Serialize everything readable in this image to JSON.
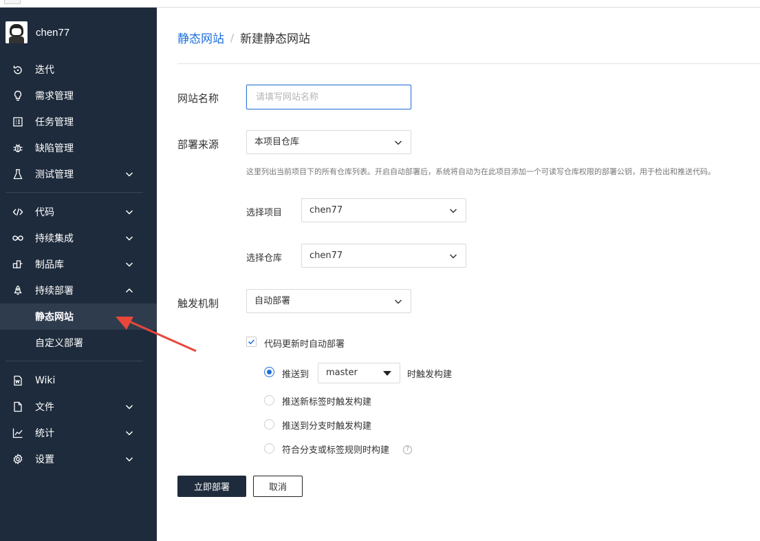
{
  "user": {
    "name": "chen77"
  },
  "sidebar": {
    "items": [
      {
        "key": "iteration",
        "label": "迭代",
        "icon": "iteration-icon",
        "chevron": ""
      },
      {
        "key": "requirements",
        "label": "需求管理",
        "icon": "lightbulb-icon",
        "chevron": ""
      },
      {
        "key": "tasks",
        "label": "任务管理",
        "icon": "task-list-icon",
        "chevron": ""
      },
      {
        "key": "defects",
        "label": "缺陷管理",
        "icon": "bug-icon",
        "chevron": ""
      },
      {
        "key": "testing",
        "label": "测试管理",
        "icon": "flask-icon",
        "chevron": "down"
      },
      {
        "key": "code",
        "label": "代码",
        "icon": "code-icon",
        "chevron": "down"
      },
      {
        "key": "ci",
        "label": "持续集成",
        "icon": "infinity-icon",
        "chevron": "down"
      },
      {
        "key": "artifacts",
        "label": "制品库",
        "icon": "artifact-icon",
        "chevron": "down"
      },
      {
        "key": "cd",
        "label": "持续部署",
        "icon": "rocket-icon",
        "chevron": "up"
      },
      {
        "key": "static-site",
        "label": "静态网站",
        "icon": "",
        "chevron": "",
        "active": true
      },
      {
        "key": "custom-deploy",
        "label": "自定义部署",
        "icon": "",
        "chevron": ""
      },
      {
        "key": "wiki",
        "label": "Wiki",
        "icon": "wiki-icon",
        "chevron": ""
      },
      {
        "key": "files",
        "label": "文件",
        "icon": "file-icon",
        "chevron": "down"
      },
      {
        "key": "stats",
        "label": "统计",
        "icon": "chart-icon",
        "chevron": "down"
      },
      {
        "key": "settings",
        "label": "设置",
        "icon": "gear-icon",
        "chevron": "down"
      }
    ]
  },
  "breadcrumb": {
    "parent": "静态网站",
    "separator": "/",
    "current": "新建静态网站"
  },
  "form": {
    "site_name": {
      "label": "网站名称",
      "value": "",
      "placeholder": "请填写网站名称"
    },
    "source": {
      "label": "部署来源",
      "value": "本项目仓库",
      "hint": "这里列出当前项目下的所有仓库列表。开启自动部署后，系统将自动为在此项目添加一个可读写仓库权限的部署公钥，用于检出和推送代码。"
    },
    "project": {
      "label": "选择项目",
      "value": "chen77"
    },
    "repo": {
      "label": "选择仓库",
      "value": "chen77"
    },
    "trigger": {
      "label": "触发机制",
      "value": "自动部署",
      "auto_deploy_checkbox": {
        "label": "代码更新时自动部署",
        "checked": true
      },
      "options": [
        {
          "label": "推送到",
          "selected": true,
          "branch": "master",
          "suffix": "时触发构建"
        },
        {
          "label": "推送新标签时触发构建",
          "selected": false
        },
        {
          "label": "推送到分支时触发构建",
          "selected": false
        },
        {
          "label": "符合分支或标签规则时构建",
          "selected": false,
          "help": "?"
        }
      ]
    }
  },
  "actions": {
    "deploy": "立即部署",
    "cancel": "取消"
  },
  "colors": {
    "sidebar_bg": "#1e2b3c",
    "sidebar_active": "#2f3c4d",
    "accent": "#1e6fd9",
    "annotation_arrow": "#e8473a"
  }
}
